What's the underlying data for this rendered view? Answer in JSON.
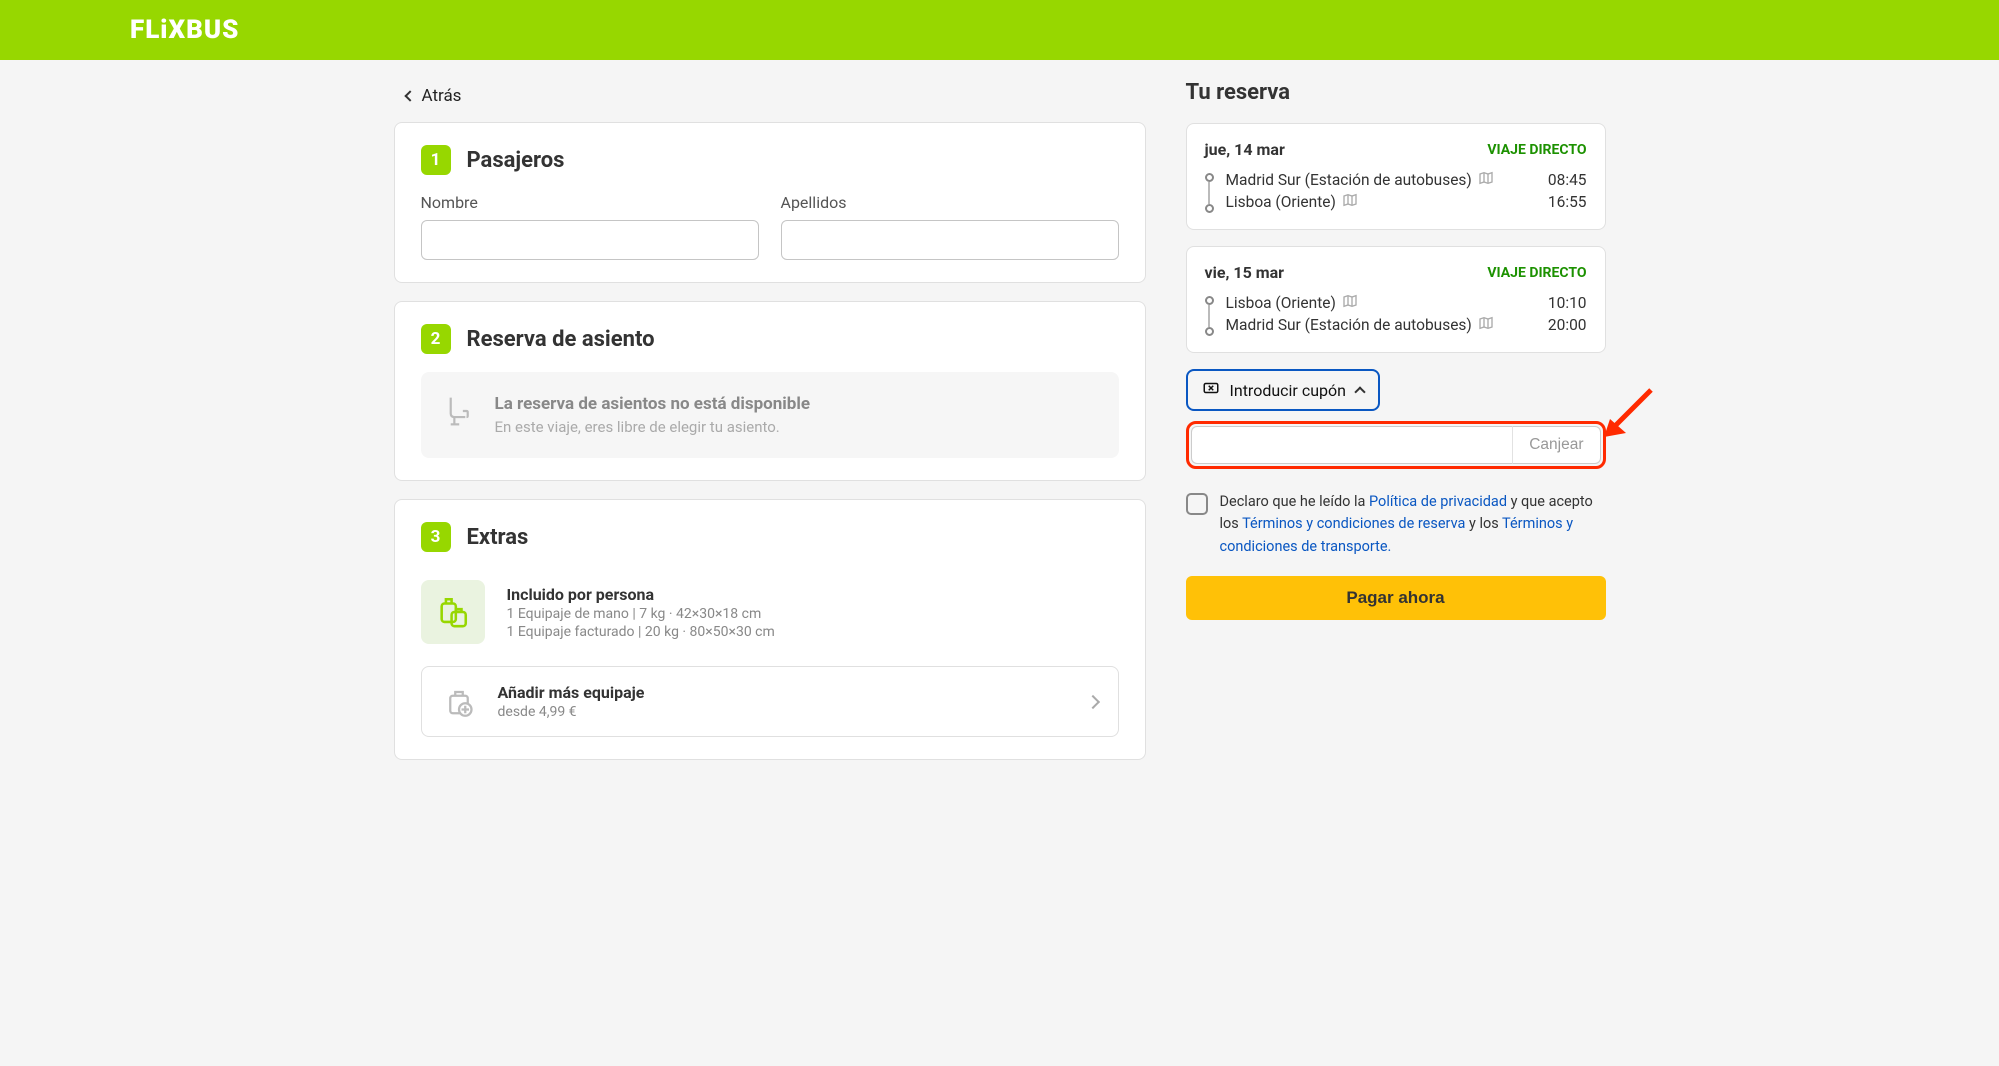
{
  "header": {
    "logo": "FLiXBUS"
  },
  "back_label": "Atrás",
  "steps": {
    "passengers": {
      "num": "1",
      "title": "Pasajeros",
      "first_name_label": "Nombre",
      "last_name_label": "Apellidos"
    },
    "seat": {
      "num": "2",
      "title": "Reserva de asiento",
      "unavailable_title": "La reserva de asientos no está disponible",
      "unavailable_sub": "En este viaje, eres libre de elegir tu asiento."
    },
    "extras": {
      "num": "3",
      "title": "Extras",
      "included_title": "Incluido por persona",
      "included_hand": "1 Equipaje de mano | 7 kg · 42×30×18 cm",
      "included_hold": "1 Equipaje facturado | 20 kg · 80×50×30 cm",
      "add_title": "Añadir más equipaje",
      "add_from": "desde 4,99 €"
    }
  },
  "booking": {
    "title": "Tu reserva",
    "trips": [
      {
        "date": "jue, 14 mar",
        "direct": "VIAJE DIRECTO",
        "from": "Madrid Sur (Estación de autobuses)",
        "from_time": "08:45",
        "to": "Lisboa (Oriente)",
        "to_time": "16:55"
      },
      {
        "date": "vie, 15 mar",
        "direct": "VIAJE DIRECTO",
        "from": "Lisboa (Oriente)",
        "from_time": "10:10",
        "to": "Madrid Sur (Estación de autobuses)",
        "to_time": "20:00"
      }
    ],
    "coupon_toggle": "Introducir cupón",
    "coupon_redeem": "Canjear",
    "terms_pre": "Declaro que he leído la ",
    "terms_privacy": "Política de privacidad",
    "terms_mid1": " y que acepto los ",
    "terms_booking": "Términos y condiciones de reserva",
    "terms_mid2": " y los ",
    "terms_transport": "Términos y condiciones de transporte.",
    "pay_label": "Pagar ahora"
  }
}
